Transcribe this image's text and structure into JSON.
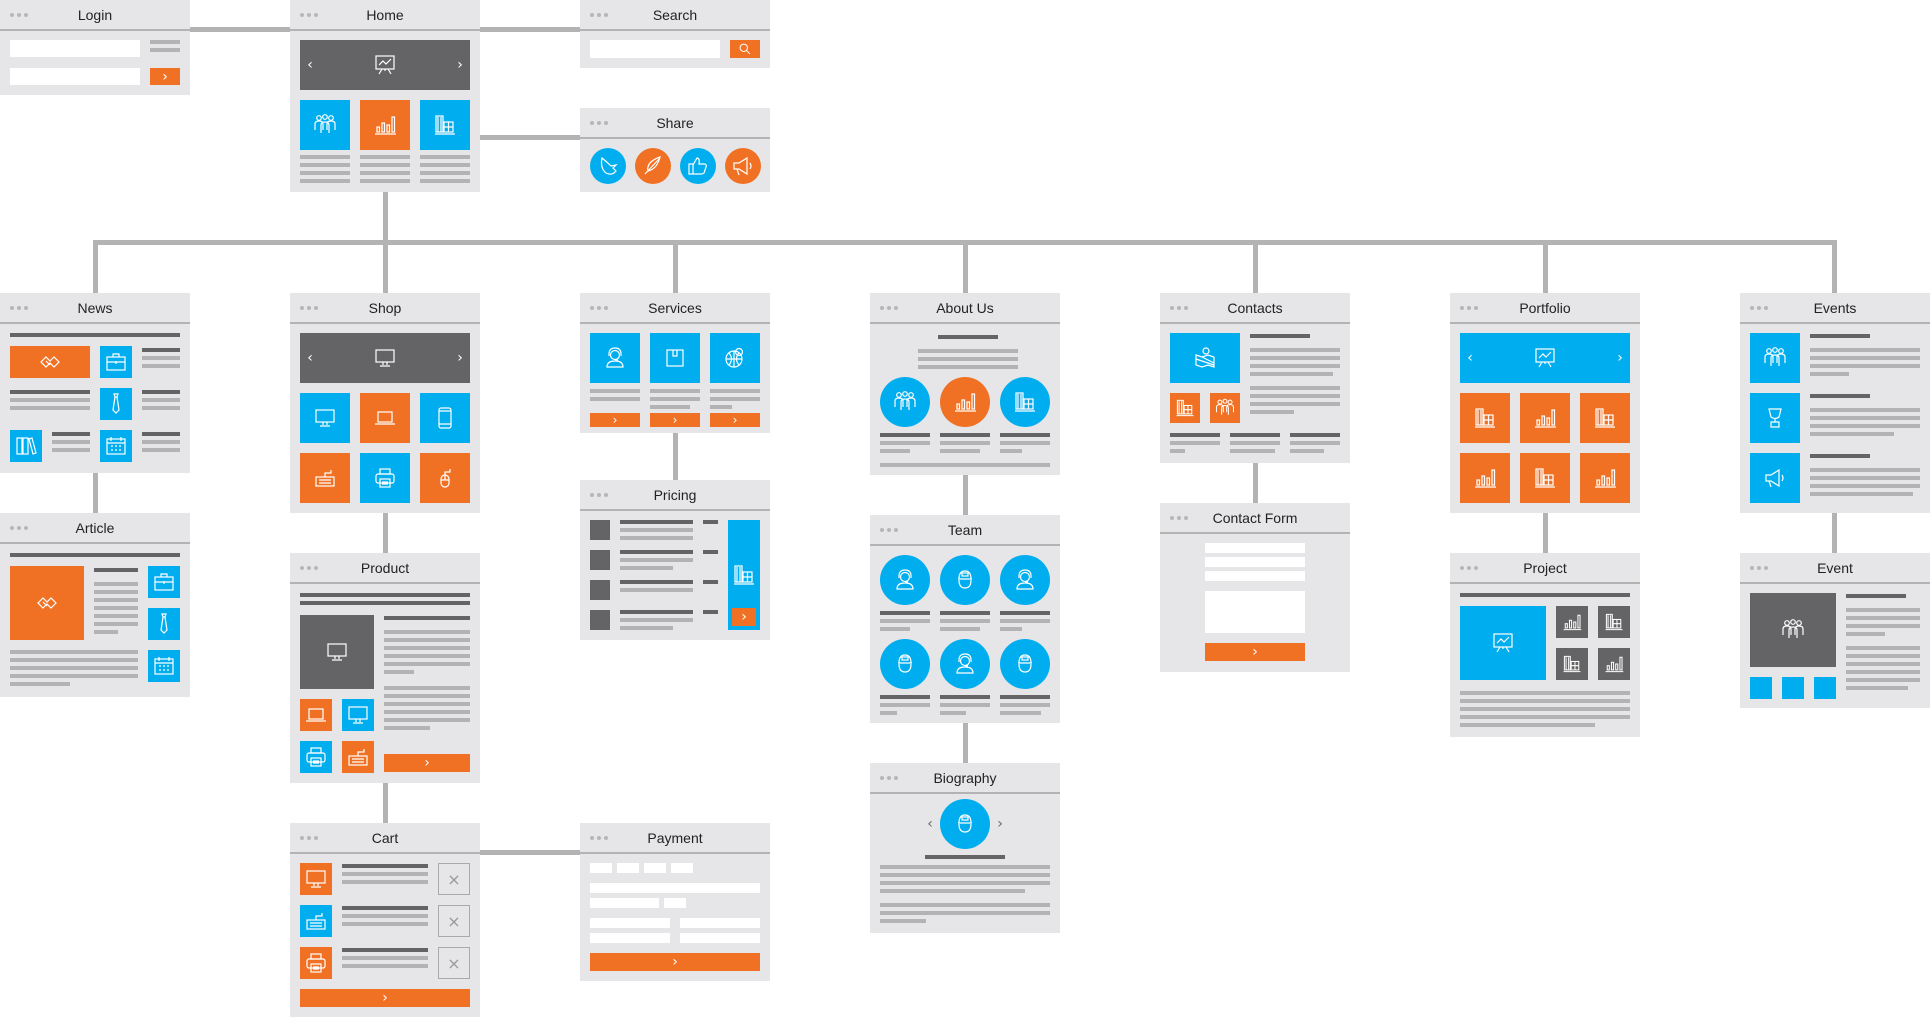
{
  "diagram": {
    "type": "website-sitemap-wireframe",
    "colors": {
      "accent_blue": "#00aeef",
      "accent_orange": "#f07124",
      "dark": "#646466",
      "panel": "#e6e6e8",
      "connector": "#b3b3b3"
    },
    "pages": {
      "login": {
        "title": "Login",
        "submit_icon": "chevron-right-icon"
      },
      "home": {
        "title": "Home",
        "carousel_icon": "presentation-chart-icon",
        "tiles": [
          "team-icon",
          "bar-chart-icon",
          "buildings-icon"
        ]
      },
      "search": {
        "title": "Search",
        "button_icon": "search-icon"
      },
      "share": {
        "title": "Share",
        "buttons": [
          "bird-icon",
          "feather-icon",
          "thumbs-up-icon",
          "megaphone-icon"
        ]
      },
      "news": {
        "title": "News"
      },
      "article": {
        "title": "Article"
      },
      "shop": {
        "title": "Shop"
      },
      "product": {
        "title": "Product"
      },
      "cart": {
        "title": "Cart",
        "remove_glyph": "×"
      },
      "services": {
        "title": "Services"
      },
      "pricing": {
        "title": "Pricing"
      },
      "payment": {
        "title": "Payment"
      },
      "about": {
        "title": "About Us"
      },
      "team": {
        "title": "Team"
      },
      "biography": {
        "title": "Biography"
      },
      "contacts": {
        "title": "Contacts"
      },
      "contact_form": {
        "title": "Contact Form"
      },
      "portfolio": {
        "title": "Portfolio"
      },
      "project": {
        "title": "Project"
      },
      "events": {
        "title": "Events"
      },
      "event": {
        "title": "Event"
      }
    },
    "glyphs": {
      "prev": "‹",
      "next": "›"
    },
    "edges": [
      [
        "Login",
        "Home"
      ],
      [
        "Home",
        "Search"
      ],
      [
        "Home",
        "Share"
      ],
      [
        "Home",
        "News"
      ],
      [
        "Home",
        "Shop"
      ],
      [
        "Home",
        "Services"
      ],
      [
        "Home",
        "About Us"
      ],
      [
        "Home",
        "Contacts"
      ],
      [
        "Home",
        "Portfolio"
      ],
      [
        "Home",
        "Events"
      ],
      [
        "News",
        "Article"
      ],
      [
        "Shop",
        "Product"
      ],
      [
        "Product",
        "Cart"
      ],
      [
        "Cart",
        "Payment"
      ],
      [
        "Services",
        "Pricing"
      ],
      [
        "About Us",
        "Team"
      ],
      [
        "Team",
        "Biography"
      ],
      [
        "Contacts",
        "Contact Form"
      ],
      [
        "Portfolio",
        "Project"
      ],
      [
        "Events",
        "Event"
      ]
    ]
  }
}
